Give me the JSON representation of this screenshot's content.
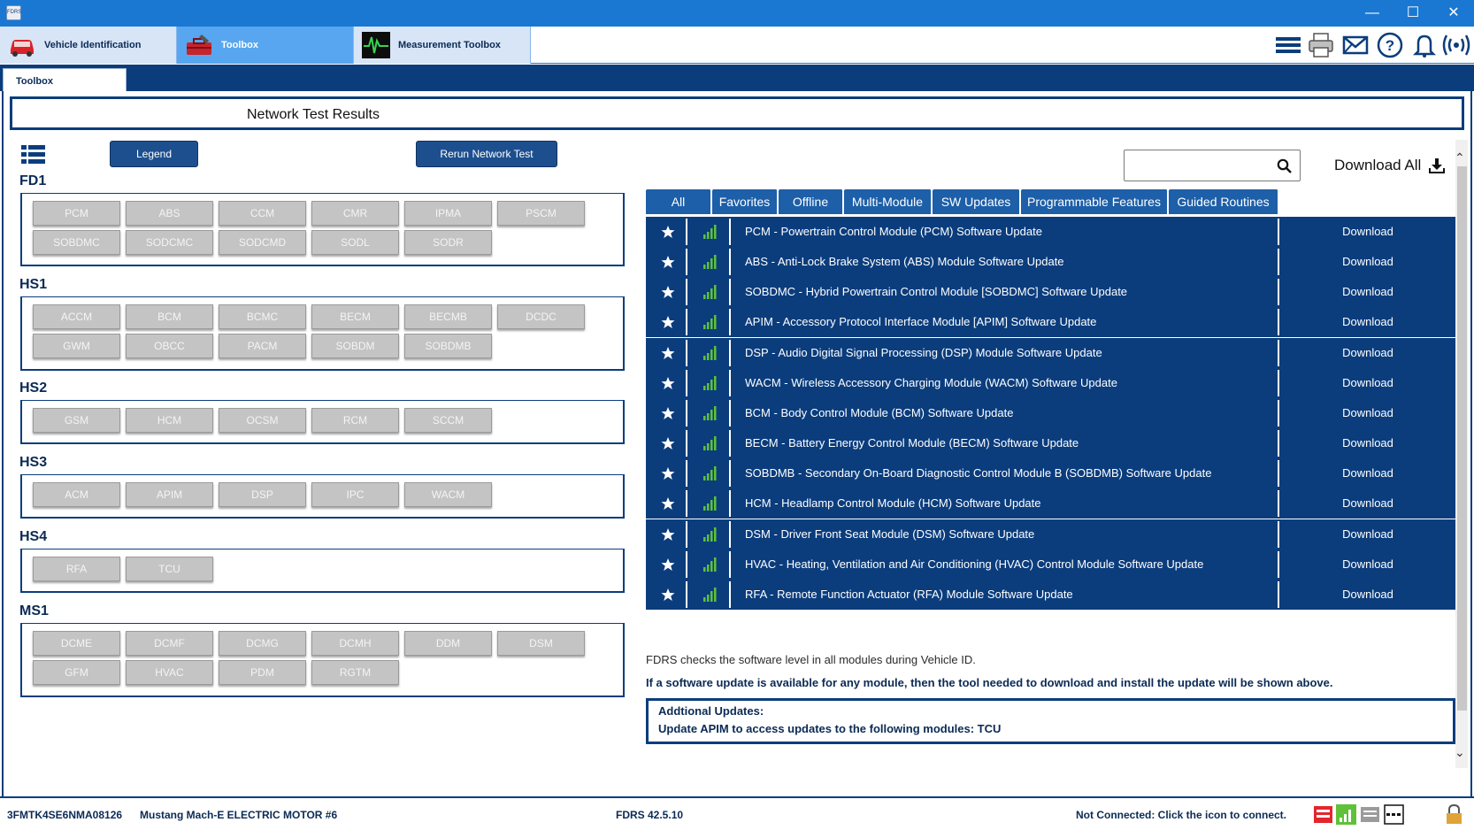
{
  "window": {
    "app_icon_text": "FDRS",
    "minimize": "—",
    "maximize": "☐",
    "close": "✕"
  },
  "top_tabs": [
    {
      "label": "Vehicle Identification",
      "icon": "car-icon"
    },
    {
      "label": "Toolbox",
      "icon": "toolbox-icon"
    },
    {
      "label": "Measurement Toolbox",
      "icon": "oscilloscope-icon"
    }
  ],
  "header_icons": [
    "menu-icon",
    "print-icon",
    "mail-icon",
    "help-icon",
    "bell-icon",
    "connection-icon"
  ],
  "sub_tab": {
    "label": "Toolbox"
  },
  "results": {
    "title": "Network Test Results"
  },
  "buttons": {
    "legend": "Legend",
    "rerun": "Rerun Network Test"
  },
  "network_groups": [
    {
      "name": "FD1",
      "modules": [
        "PCM",
        "ABS",
        "CCM",
        "CMR",
        "IPMA",
        "PSCM",
        "SOBDMC",
        "SODCMC",
        "SODCMD",
        "SODL",
        "SODR"
      ]
    },
    {
      "name": "HS1",
      "modules": [
        "ACCM",
        "BCM",
        "BCMC",
        "BECM",
        "BECMB",
        "DCDC",
        "GWM",
        "OBCC",
        "PACM",
        "SOBDM",
        "SOBDMB"
      ]
    },
    {
      "name": "HS2",
      "modules": [
        "GSM",
        "HCM",
        "OCSM",
        "RCM",
        "SCCM"
      ]
    },
    {
      "name": "HS3",
      "modules": [
        "ACM",
        "APIM",
        "DSP",
        "IPC",
        "WACM"
      ]
    },
    {
      "name": "HS4",
      "modules": [
        "RFA",
        "TCU"
      ]
    },
    {
      "name": "MS1",
      "modules": [
        "DCME",
        "DCMF",
        "DCMG",
        "DCMH",
        "DDM",
        "DSM",
        "GFM",
        "HVAC",
        "PDM",
        "RGTM"
      ]
    }
  ],
  "search": {
    "value": "",
    "placeholder": ""
  },
  "download_all": "Download All",
  "filter_tabs": [
    "All",
    "Favorites",
    "Offline",
    "Multi-Module",
    "SW Updates",
    "Programmable Features",
    "Guided Routines"
  ],
  "updates": [
    {
      "title": "PCM - Powertrain Control Module (PCM) Software Update",
      "action": "Download"
    },
    {
      "title": "ABS - Anti-Lock Brake System (ABS) Module Software Update",
      "action": "Download"
    },
    {
      "title": "SOBDMC - Hybrid Powertrain Control Module [SOBDMC] Software Update",
      "action": "Download"
    },
    {
      "title": "APIM - Accessory Protocol Interface Module [APIM] Software Update",
      "action": "Download"
    },
    {
      "title": "DSP - Audio Digital Signal Processing (DSP) Module Software Update",
      "action": "Download"
    },
    {
      "title": "WACM - Wireless Accessory Charging Module (WACM) Software Update",
      "action": "Download"
    },
    {
      "title": "BCM - Body Control Module (BCM) Software Update",
      "action": "Download"
    },
    {
      "title": "BECM - Battery Energy Control Module (BECM) Software Update",
      "action": "Download"
    },
    {
      "title": "SOBDMB - Secondary On-Board Diagnostic Control Module B (SOBDMB) Software Update",
      "action": "Download"
    },
    {
      "title": "HCM - Headlamp Control Module (HCM) Software Update",
      "action": "Download"
    },
    {
      "title": "DSM - Driver Front Seat Module (DSM) Software Update",
      "action": "Download"
    },
    {
      "title": "HVAC - Heating, Ventilation and Air Conditioning (HVAC) Control Module Software Update",
      "action": "Download"
    },
    {
      "title": "RFA - Remote Function Actuator (RFA) Module Software Update",
      "action": "Download"
    }
  ],
  "info": {
    "line1": "FDRS checks the software level in all modules during Vehicle ID.",
    "line2": "If a software update is available for any module, then the tool needed to download and install the update will be shown above.",
    "additional_title": "Addtional Updates:",
    "additional_text": "Update APIM to access updates to the following modules: TCU"
  },
  "status": {
    "vin": "3FMTK4SE6NMA08126",
    "vehicle": "Mustang Mach-E ELECTRIC MOTOR #6",
    "version": "FDRS 42.5.10",
    "connection": "Not Connected: Click the icon to connect."
  },
  "colors": {
    "brand": "#0b3d7d",
    "title_bar": "#1a78d2",
    "module_button": "#c4c4c4",
    "signal": "#5fc13a"
  }
}
